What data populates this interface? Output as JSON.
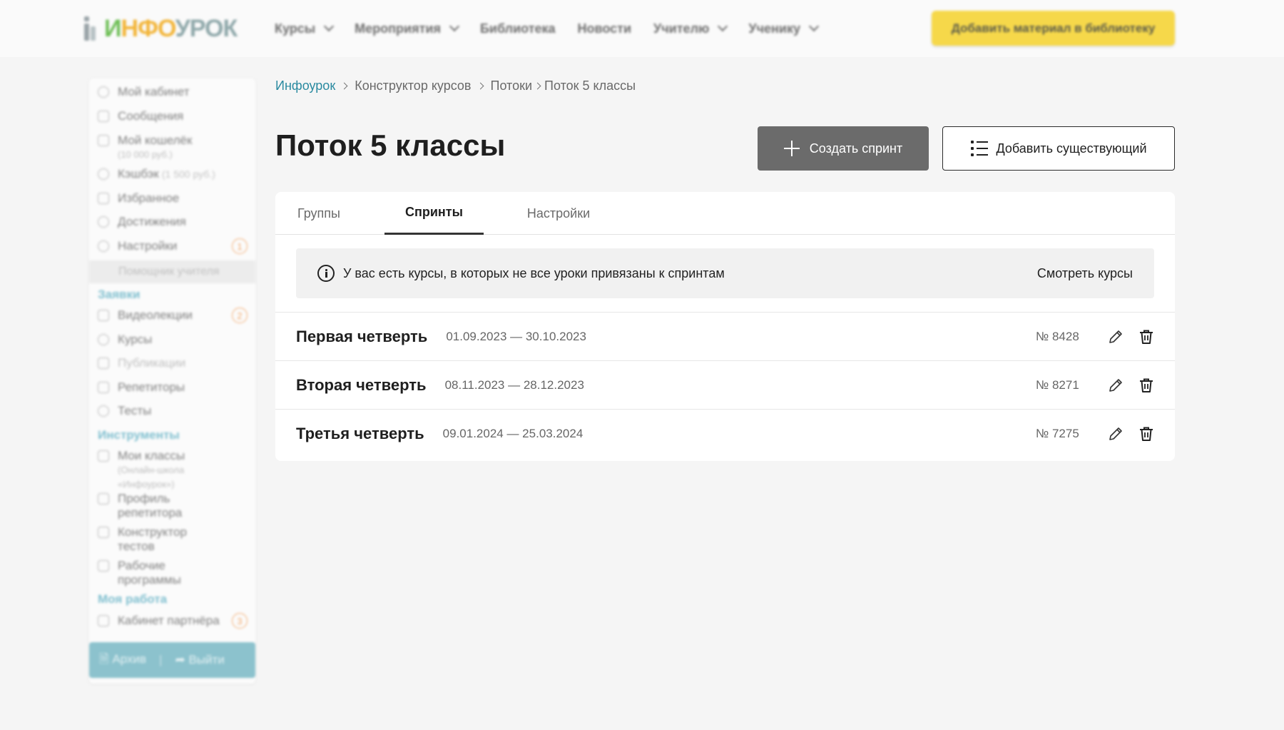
{
  "header": {
    "logo": {
      "text_parts": [
        "И",
        "НФО",
        "УРОК"
      ]
    },
    "nav": [
      {
        "label": "Курсы",
        "has_dropdown": true
      },
      {
        "label": "Мероприятия",
        "has_dropdown": true
      },
      {
        "label": "Библиотека",
        "has_dropdown": false
      },
      {
        "label": "Новости",
        "has_dropdown": false
      },
      {
        "label": "Учителю",
        "has_dropdown": true
      },
      {
        "label": "Ученику",
        "has_dropdown": true
      }
    ],
    "add_material_label": "Добавить материал в библиотеку",
    "add_material_color": "#f6d84a"
  },
  "sidebar": {
    "items": [
      {
        "label": "Мой кабинет",
        "icon": "account-icon"
      },
      {
        "label": "Сообщения",
        "icon": "mail-icon"
      },
      {
        "label": "Мой кошелёк",
        "sub": "(10 000 руб.)",
        "icon": "wallet-icon"
      },
      {
        "label": "Кэшбэк",
        "inline_sub": "(1 500 руб.)",
        "icon": "cashback-icon"
      },
      {
        "label": "Избранное",
        "icon": "bookmark-icon"
      },
      {
        "label": "Достижения",
        "icon": "trophy-icon"
      },
      {
        "label": "Настройки",
        "icon": "settings-icon",
        "badge": "1"
      }
    ],
    "helper_label": "Помощник учителя",
    "sections": {
      "requests": {
        "title": "Заявки",
        "items": [
          {
            "label": "Видеолекции",
            "icon": "video-icon",
            "badge": "2"
          },
          {
            "label": "Курсы",
            "icon": "courses-icon"
          },
          {
            "label": "Публикации",
            "icon": "publications-icon"
          },
          {
            "label": "Репетиторы",
            "icon": "tutors-icon"
          },
          {
            "label": "Тесты",
            "icon": "tests-icon"
          }
        ]
      },
      "tools": {
        "title": "Инструменты",
        "items": [
          {
            "label": "Мои классы",
            "sub1": "(Онлайн-школа",
            "sub2": "«Инфоурок»)",
            "icon": "classes-icon"
          },
          {
            "label": "Профиль",
            "label2": "репетитора",
            "icon": "profile-icon"
          },
          {
            "label": "Конструктор",
            "label2": "тестов",
            "icon": "test-builder-icon"
          },
          {
            "label": "Рабочие",
            "label2": "программы",
            "icon": "calendar-icon"
          }
        ]
      },
      "work": {
        "title": "Моя работа",
        "items": [
          {
            "label": "Кабинет партнёра",
            "icon": "partner-icon",
            "badge": "3"
          }
        ]
      }
    },
    "footer": {
      "archive_label": "Архив",
      "separator": "|",
      "logout_label": "Выйти"
    }
  },
  "breadcrumb": {
    "items": [
      "Инфоурок",
      "Конструктор курсов",
      "Потоки",
      "Поток 5 классы"
    ]
  },
  "page": {
    "title": "Поток 5 классы",
    "create_sprint_label": "Создать спринт",
    "add_existing_label": "Добавить существующий"
  },
  "tabs": [
    {
      "label": "Группы",
      "active": false
    },
    {
      "label": "Спринты",
      "active": true
    },
    {
      "label": "Настройки",
      "active": false
    }
  ],
  "notice": {
    "text": "У вас есть курсы, в которых не все уроки привязаны к спринтам",
    "link_label": "Смотреть курсы"
  },
  "sprints": [
    {
      "name": "Первая четверть",
      "dates": "01.09.2023 — 30.10.2023",
      "number": "№ 8428"
    },
    {
      "name": "Вторая четверть",
      "dates": "08.11.2023 — 28.12.2023",
      "number": "№ 8271"
    },
    {
      "name": "Третья четверть",
      "dates": "09.01.2024 — 25.03.2024",
      "number": "№ 7275"
    }
  ]
}
